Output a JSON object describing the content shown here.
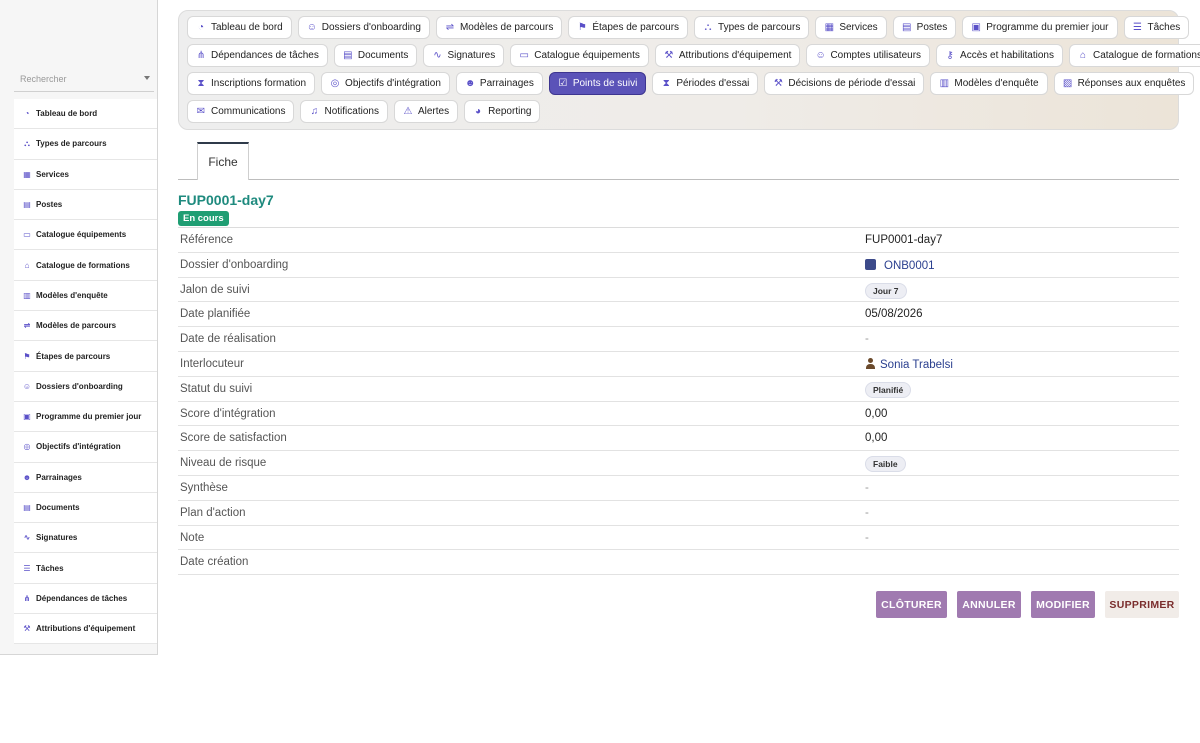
{
  "sidebar": {
    "search_placeholder": "Rechercher",
    "items": [
      {
        "label": "Tableau de bord",
        "icon": "dashboard-icon",
        "glyph": "◔"
      },
      {
        "label": "Types de parcours",
        "icon": "sitemap-icon",
        "glyph": "⛬"
      },
      {
        "label": "Services",
        "icon": "building-icon",
        "glyph": "▦"
      },
      {
        "label": "Postes",
        "icon": "badge-icon",
        "glyph": "▤"
      },
      {
        "label": "Catalogue équipements",
        "icon": "laptop-icon",
        "glyph": "▭"
      },
      {
        "label": "Catalogue de formations",
        "icon": "graduation-cap-icon",
        "glyph": "⌂"
      },
      {
        "label": "Modèles d'enquête",
        "icon": "clipboard-icon",
        "glyph": "▥"
      },
      {
        "label": "Modèles de parcours",
        "icon": "signpost-icon",
        "glyph": "⇌"
      },
      {
        "label": "Étapes de parcours",
        "icon": "flag-icon",
        "glyph": "⚑"
      },
      {
        "label": "Dossiers d'onboarding",
        "icon": "user-plus-icon",
        "glyph": "☺"
      },
      {
        "label": "Programme du premier jour",
        "icon": "calendar-icon",
        "glyph": "▣"
      },
      {
        "label": "Objectifs d'intégration",
        "icon": "target-icon",
        "glyph": "◎"
      },
      {
        "label": "Parrainages",
        "icon": "users-icon",
        "glyph": "☻"
      },
      {
        "label": "Documents",
        "icon": "file-icon",
        "glyph": "▤"
      },
      {
        "label": "Signatures",
        "icon": "signature-icon",
        "glyph": "∿"
      },
      {
        "label": "Tâches",
        "icon": "list-icon",
        "glyph": "☰"
      },
      {
        "label": "Dépendances de tâches",
        "icon": "diagram-icon",
        "glyph": "⋔"
      },
      {
        "label": "Attributions d'équipement",
        "icon": "dolly-icon",
        "glyph": "⚒"
      }
    ]
  },
  "topnav": {
    "rows": [
      [
        {
          "label": "Tableau de bord",
          "icon": "dashboard-icon",
          "glyph": "◔"
        },
        {
          "label": "Dossiers d'onboarding",
          "icon": "user-plus-icon",
          "glyph": "☺"
        },
        {
          "label": "Modèles de parcours",
          "icon": "signpost-icon",
          "glyph": "⇌"
        },
        {
          "label": "Étapes de parcours",
          "icon": "flag-icon",
          "glyph": "⚑"
        },
        {
          "label": "Types de parcours",
          "icon": "sitemap-icon",
          "glyph": "⛬"
        },
        {
          "label": "Services",
          "icon": "building-icon",
          "glyph": "▦"
        },
        {
          "label": "Postes",
          "icon": "badge-icon",
          "glyph": "▤"
        },
        {
          "label": "Programme du premier jour",
          "icon": "calendar-icon",
          "glyph": "▣"
        },
        {
          "label": "Tâches",
          "icon": "list-icon",
          "glyph": "☰"
        }
      ],
      [
        {
          "label": "Dépendances de tâches",
          "icon": "diagram-icon",
          "glyph": "⋔"
        },
        {
          "label": "Documents",
          "icon": "file-icon",
          "glyph": "▤"
        },
        {
          "label": "Signatures",
          "icon": "signature-icon",
          "glyph": "∿"
        },
        {
          "label": "Catalogue équipements",
          "icon": "laptop-icon",
          "glyph": "▭"
        },
        {
          "label": "Attributions d'équipement",
          "icon": "dolly-icon",
          "glyph": "⚒"
        },
        {
          "label": "Comptes utilisateurs",
          "icon": "user-gear-icon",
          "glyph": "☺"
        },
        {
          "label": "Accès et habilitations",
          "icon": "key-icon",
          "glyph": "⚷"
        },
        {
          "label": "Catalogue de formations",
          "icon": "graduation-cap-icon",
          "glyph": "⌂"
        }
      ],
      [
        {
          "label": "Inscriptions formation",
          "icon": "hourglass-icon",
          "glyph": "⧗"
        },
        {
          "label": "Objectifs d'intégration",
          "icon": "target-icon",
          "glyph": "◎"
        },
        {
          "label": "Parrainages",
          "icon": "users-icon",
          "glyph": "☻"
        },
        {
          "label": "Points de suivi",
          "icon": "clipboard-check-icon",
          "glyph": "☑",
          "active": true
        },
        {
          "label": "Périodes d'essai",
          "icon": "hourglass-icon",
          "glyph": "⧗"
        },
        {
          "label": "Décisions de période d'essai",
          "icon": "gavel-icon",
          "glyph": "⚒"
        },
        {
          "label": "Modèles d'enquête",
          "icon": "clipboard-icon",
          "glyph": "▥"
        },
        {
          "label": "Réponses aux enquêtes",
          "icon": "chart-icon",
          "glyph": "▨"
        }
      ],
      [
        {
          "label": "Communications",
          "icon": "envelope-icon",
          "glyph": "✉"
        },
        {
          "label": "Notifications",
          "icon": "bell-icon",
          "glyph": "♫"
        },
        {
          "label": "Alertes",
          "icon": "warning-icon",
          "glyph": "⚠"
        },
        {
          "label": "Reporting",
          "icon": "pie-chart-icon",
          "glyph": "◕"
        }
      ]
    ]
  },
  "tab": {
    "label": "Fiche"
  },
  "record": {
    "title": "FUP0001-day7",
    "status": "En cours",
    "fields": [
      {
        "label": "Référence",
        "value": "FUP0001-day7",
        "kind": "text"
      },
      {
        "label": "Dossier d'onboarding",
        "value": "ONB0001",
        "kind": "link"
      },
      {
        "label": "Jalon de suivi",
        "value": "Jour 7",
        "kind": "pill"
      },
      {
        "label": "Date planifiée",
        "value": "05/08/2026",
        "kind": "text"
      },
      {
        "label": "Date de réalisation",
        "value": "-",
        "kind": "dash"
      },
      {
        "label": "Interlocuteur",
        "value": "Sonia Trabelsi",
        "kind": "person"
      },
      {
        "label": "Statut du suivi",
        "value": "Planifié",
        "kind": "pill"
      },
      {
        "label": "Score d'intégration",
        "value": "0,00",
        "kind": "text"
      },
      {
        "label": "Score de satisfaction",
        "value": "0,00",
        "kind": "text"
      },
      {
        "label": "Niveau de risque",
        "value": "Faible",
        "kind": "pill"
      },
      {
        "label": "Synthèse",
        "value": "-",
        "kind": "dash"
      },
      {
        "label": "Plan d'action",
        "value": "-",
        "kind": "dash"
      },
      {
        "label": "Note",
        "value": "-",
        "kind": "dash"
      },
      {
        "label": "Date création",
        "value": "",
        "kind": "text"
      }
    ]
  },
  "actions": {
    "close_label": "CLÔTURER",
    "cancel_label": "ANNULER",
    "edit_label": "MODIFIER",
    "delete_label": "SUPPRIMER"
  }
}
